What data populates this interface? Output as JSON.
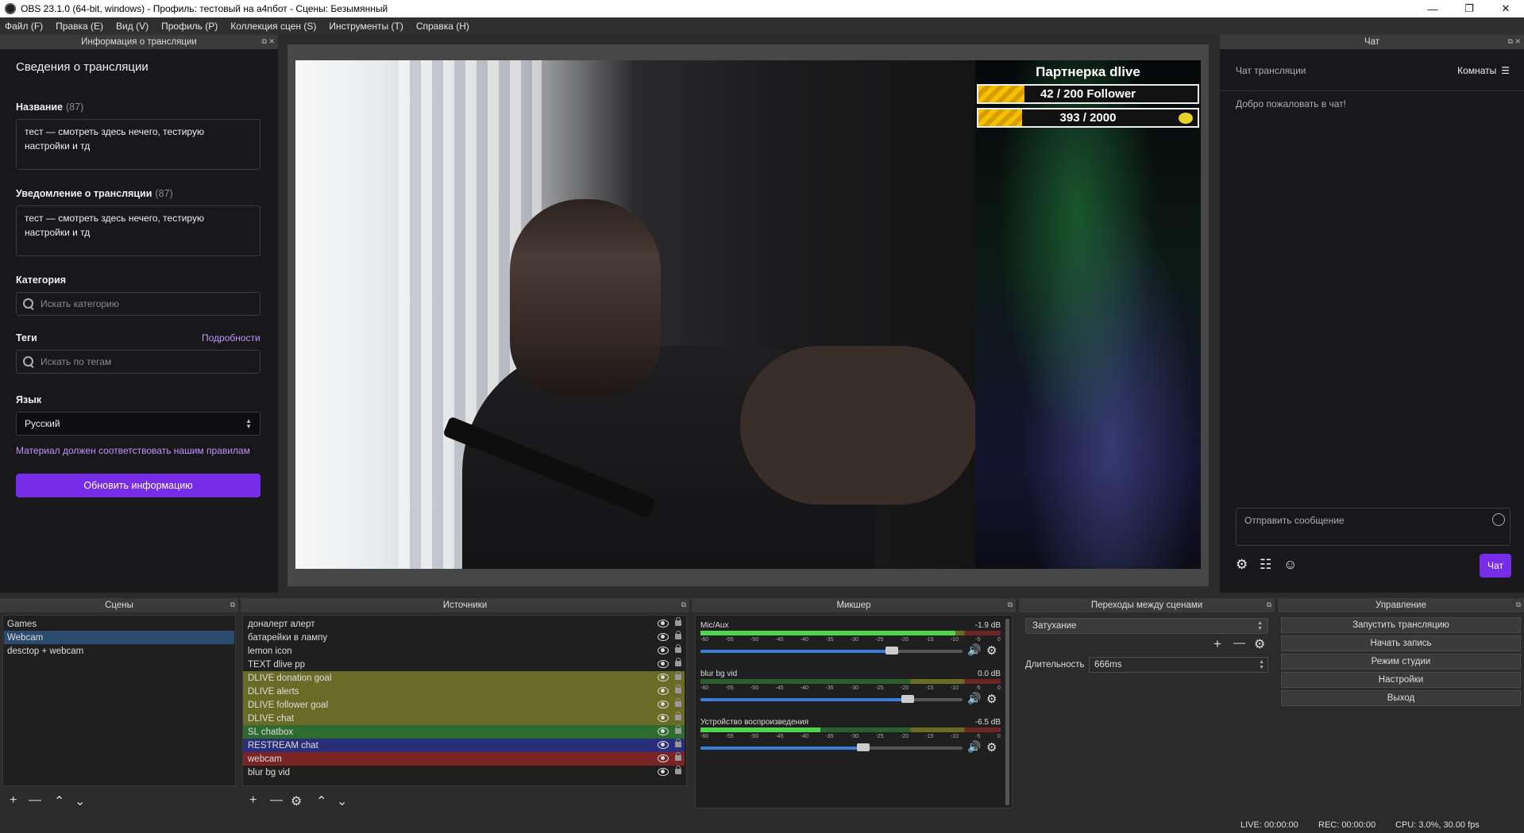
{
  "window": {
    "title": "OBS 23.1.0 (64-bit, windows) - Профиль: тестовый на a4nбот - Сцены: Безымянный",
    "controls": [
      "—",
      "❐",
      "✕"
    ]
  },
  "menu": [
    "Файл (F)",
    "Правка (E)",
    "Вид (V)",
    "Профиль (P)",
    "Коллекция сцен (S)",
    "Инструменты (T)",
    "Справка (H)"
  ],
  "info_dock": {
    "dock_title": "Информация о трансляции",
    "heading": "Сведения о трансляции",
    "title_label": "Название",
    "title_count": "(87)",
    "title_value": "тест — смотреть здесь нечего, тестирую настройки и тд",
    "notification_label": "Уведомление о трансляции",
    "notification_count": "(87)",
    "notification_value": "тест — смотреть здесь нечего, тестирую настройки и тд",
    "category_label": "Категория",
    "category_placeholder": "Искать категорию",
    "tags_label": "Теги",
    "tags_link": "Подробности",
    "tags_placeholder": "Искать по тегам",
    "language_label": "Язык",
    "language_value": "Русский",
    "rules_link": "Материал должен соответствовать нашим правилам",
    "update_button": "Обновить информацию"
  },
  "preview": {
    "overlay_title": "Партнерка dlive",
    "goal1": {
      "text": "42 / 200 Follower",
      "progress": 0.21
    },
    "goal2": {
      "text": "393 / 2000",
      "progress": 0.2
    }
  },
  "chat_dock": {
    "dock_title": "Чат",
    "chat_header": "Чат трансляции",
    "rooms": "Комнаты",
    "welcome": "Добро пожаловать в чат!",
    "input_placeholder": "Отправить сообщение",
    "send_button": "Чат"
  },
  "scenes": {
    "dock_title": "Сцены",
    "items": [
      "Games",
      "Webcam",
      "desctop + webcam"
    ],
    "selected": "Webcam"
  },
  "sources": {
    "dock_title": "Источники",
    "items": [
      {
        "name": "доналерт алерт",
        "color": ""
      },
      {
        "name": "батарейки в лампу",
        "color": ""
      },
      {
        "name": "lemon icon",
        "color": ""
      },
      {
        "name": "TEXT dlive pp",
        "color": ""
      },
      {
        "name": "DLIVE donation goal",
        "color": "#6b6b28"
      },
      {
        "name": "DLIVE alerts",
        "color": "#6b6b28"
      },
      {
        "name": "DLIVE follower goal",
        "color": "#6b6b28"
      },
      {
        "name": "DLIVE chat",
        "color": "#6b6b28"
      },
      {
        "name": "SL chatbox",
        "color": "#2e6b2e"
      },
      {
        "name": "RESTREAM chat",
        "color": "#2b2f7a"
      },
      {
        "name": "webcam",
        "color": "#7a2525"
      },
      {
        "name": "blur bg vid",
        "color": ""
      }
    ]
  },
  "mixer": {
    "dock_title": "Микшер",
    "scale": [
      "-60",
      "-55",
      "-50",
      "-45",
      "-40",
      "-35",
      "-30",
      "-25",
      "-20",
      "-15",
      "-10",
      "-5",
      "0"
    ],
    "channels": [
      {
        "name": "Mic/Aux",
        "db": "-1.9 dB",
        "level": 0.85,
        "volume": 0.73
      },
      {
        "name": "blur bg vid",
        "db": "0.0 dB",
        "level": 0.0,
        "volume": 0.79
      },
      {
        "name": "Устройство воспроизведения",
        "db": "-6.5 dB",
        "level": 0.4,
        "volume": 0.62
      }
    ]
  },
  "transitions": {
    "dock_title": "Переходы между сценами",
    "selected": "Затухание",
    "duration_label": "Длительность",
    "duration_value": "666ms"
  },
  "controls": {
    "dock_title": "Управление",
    "buttons": [
      "Запустить трансляцию",
      "Начать запись",
      "Режим студии",
      "Настройки",
      "Выход"
    ]
  },
  "status": {
    "live": "LIVE: 00:00:00",
    "rec": "REC: 00:00:00",
    "cpu": "CPU: 3.0%, 30.00 fps"
  }
}
